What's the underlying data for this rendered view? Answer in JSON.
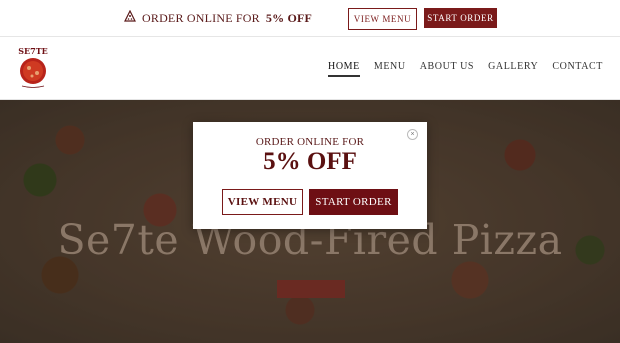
{
  "promo_bar": {
    "icon": "pizza-slice-icon",
    "text_prefix": "ORDER ONLINE FOR",
    "text_discount": "5% OFF",
    "view_menu_label": "VIEW MENU",
    "start_order_label": "START ORDER"
  },
  "header": {
    "logo_text": "SE7TE",
    "nav": [
      "HOME",
      "MENU",
      "ABOUT US",
      "GALLERY",
      "CONTACT"
    ],
    "active_nav": "HOME"
  },
  "hero": {
    "title": "Se7te Wood-Fired Pizza"
  },
  "modal": {
    "line1": "ORDER ONLINE FOR",
    "line2": "5% OFF",
    "view_menu_label": "VIEW MENU",
    "start_order_label": "START ORDER",
    "close_icon": "close-icon"
  },
  "colors": {
    "brand_maroon": "#6e0f14",
    "text_maroon": "#5a1a1a"
  }
}
